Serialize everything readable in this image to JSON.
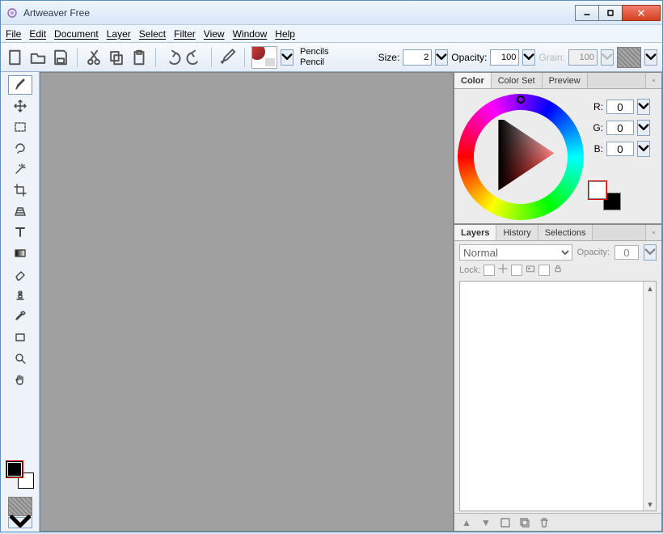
{
  "window": {
    "title": "Artweaver Free"
  },
  "menu": [
    "File",
    "Edit",
    "Document",
    "Layer",
    "Select",
    "Filter",
    "View",
    "Window",
    "Help"
  ],
  "toolbar": {
    "brush_category": "Pencils",
    "brush_name": "Pencil",
    "size_label": "Size:",
    "size_value": "2",
    "opacity_label": "Opacity:",
    "opacity_value": "100",
    "grain_label": "Grain:",
    "grain_value": "100"
  },
  "tools": [
    {
      "name": "brush-tool",
      "selected": true
    },
    {
      "name": "move-tool"
    },
    {
      "name": "rect-select-tool"
    },
    {
      "name": "lasso-tool"
    },
    {
      "name": "magic-wand-tool"
    },
    {
      "name": "crop-tool"
    },
    {
      "name": "perspective-grid-tool"
    },
    {
      "name": "text-tool"
    },
    {
      "name": "gradient-tool"
    },
    {
      "name": "eraser-tool"
    },
    {
      "name": "stamp-tool"
    },
    {
      "name": "eyedropper-tool"
    },
    {
      "name": "shape-tool"
    },
    {
      "name": "zoom-tool"
    },
    {
      "name": "hand-tool"
    }
  ],
  "color_panel": {
    "tabs": [
      "Color",
      "Color Set",
      "Preview"
    ],
    "active_tab": "Color",
    "r_label": "R:",
    "r_value": "0",
    "g_label": "G:",
    "g_value": "0",
    "b_label": "B:",
    "b_value": "0"
  },
  "layer_panel": {
    "tabs": [
      "Layers",
      "History",
      "Selections"
    ],
    "active_tab": "Layers",
    "blend_mode": "Normal",
    "opacity_label": "Opacity:",
    "opacity_value": "0",
    "lock_label": "Lock:"
  }
}
